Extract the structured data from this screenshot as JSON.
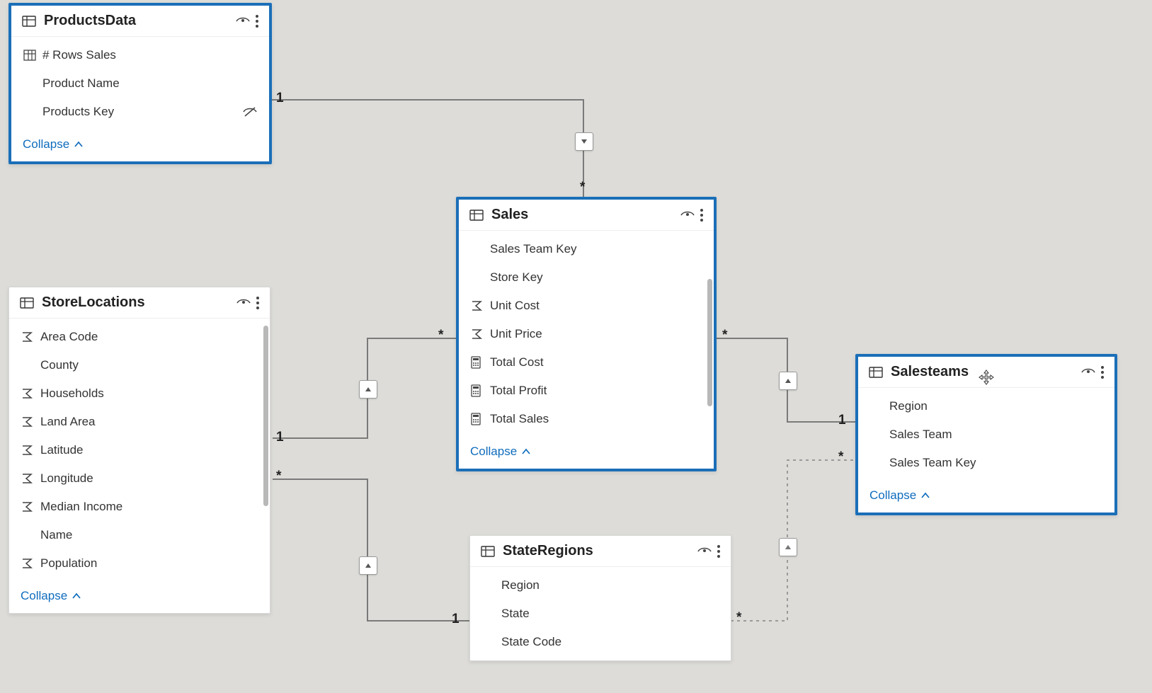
{
  "collapse_label": "Collapse",
  "tables": {
    "products": {
      "title": "ProductsData",
      "fields": [
        {
          "label": "# Rows Sales",
          "icon": "measure",
          "hidden": false
        },
        {
          "label": "Product Name",
          "icon": "none",
          "hidden": false
        },
        {
          "label": "Products Key",
          "icon": "none",
          "hidden": true
        }
      ]
    },
    "sales": {
      "title": "Sales",
      "fields": [
        {
          "label": "Sales Team Key",
          "icon": "none"
        },
        {
          "label": "Store Key",
          "icon": "none"
        },
        {
          "label": "Unit Cost",
          "icon": "sigma"
        },
        {
          "label": "Unit Price",
          "icon": "sigma"
        },
        {
          "label": "Total Cost",
          "icon": "calc"
        },
        {
          "label": "Total Profit",
          "icon": "calc"
        },
        {
          "label": "Total Sales",
          "icon": "calc"
        }
      ]
    },
    "storelocations": {
      "title": "StoreLocations",
      "fields": [
        {
          "label": "Area Code",
          "icon": "sigma"
        },
        {
          "label": "County",
          "icon": "none"
        },
        {
          "label": "Households",
          "icon": "sigma"
        },
        {
          "label": "Land Area",
          "icon": "sigma"
        },
        {
          "label": "Latitude",
          "icon": "sigma"
        },
        {
          "label": "Longitude",
          "icon": "sigma"
        },
        {
          "label": "Median Income",
          "icon": "sigma"
        },
        {
          "label": "Name",
          "icon": "none"
        },
        {
          "label": "Population",
          "icon": "sigma"
        }
      ]
    },
    "stateregions": {
      "title": "StateRegions",
      "fields": [
        {
          "label": "Region",
          "icon": "none"
        },
        {
          "label": "State",
          "icon": "none"
        },
        {
          "label": "State Code",
          "icon": "none"
        }
      ]
    },
    "salesteams": {
      "title": "Salesteams",
      "fields": [
        {
          "label": "Region",
          "icon": "none"
        },
        {
          "label": "Sales Team",
          "icon": "none"
        },
        {
          "label": "Sales Team Key",
          "icon": "none"
        }
      ]
    }
  },
  "cardinality": {
    "one": "1",
    "many": "*"
  }
}
